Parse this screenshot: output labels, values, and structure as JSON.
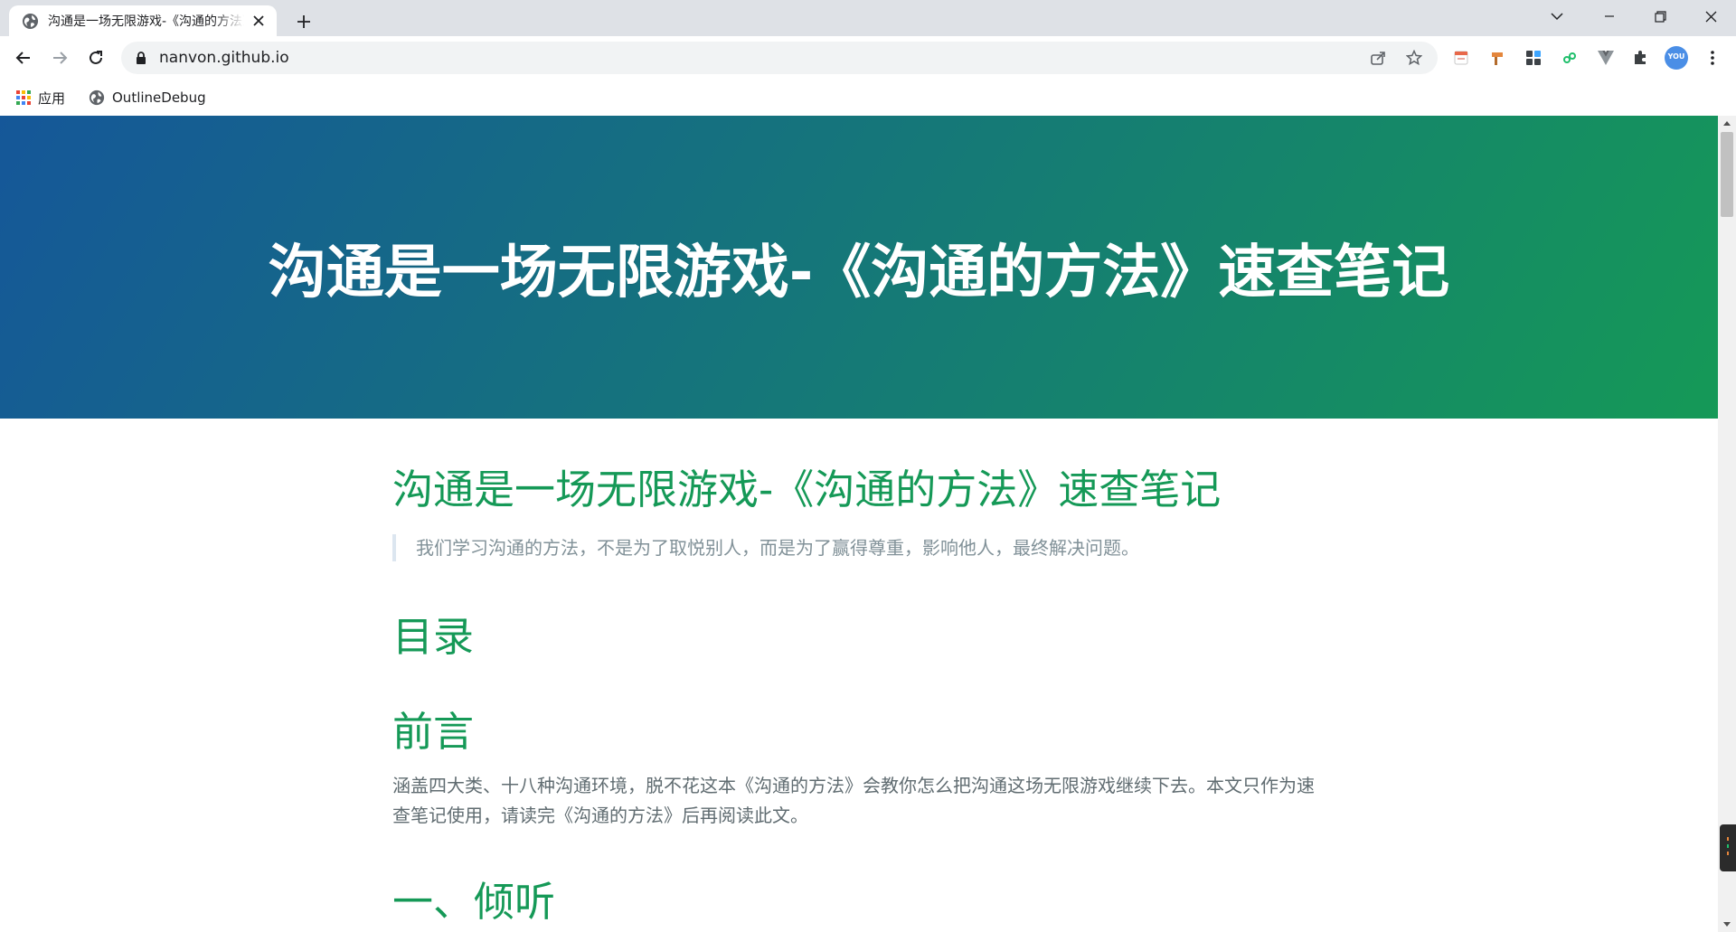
{
  "browser": {
    "tab_title": "沟通是一场无限游戏-《沟通的方法》速查笔记",
    "url": "nanvon.github.io",
    "bookmarks": [
      {
        "label": "应用",
        "icon": "apps-grid-icon"
      },
      {
        "label": "OutlineDebug",
        "icon": "globe-icon"
      }
    ],
    "profile_badge": "YOU"
  },
  "page": {
    "hero_title": "沟通是一场无限游戏-《沟通的方法》速查笔记",
    "heading": "沟通是一场无限游戏-《沟通的方法》速查笔记",
    "quote": "我们学习沟通的方法，不是为了取悦别人，而是为了赢得尊重，影响他人，最终解决问题。",
    "toc_heading": "目录",
    "preface_heading": "前言",
    "preface_text": "涵盖四大类、十八种沟通环境，脱不花这本《沟通的方法》会教你怎么把沟通这场无限游戏继续下去。本文只作为速查笔记使用，请读完《沟通的方法》后再阅读此文。",
    "section1_heading": "一、倾听"
  },
  "colors": {
    "hero_start": "#155799",
    "hero_end": "#159957",
    "heading": "#159957",
    "body_text": "#606c71",
    "quote_text": "#819198"
  }
}
